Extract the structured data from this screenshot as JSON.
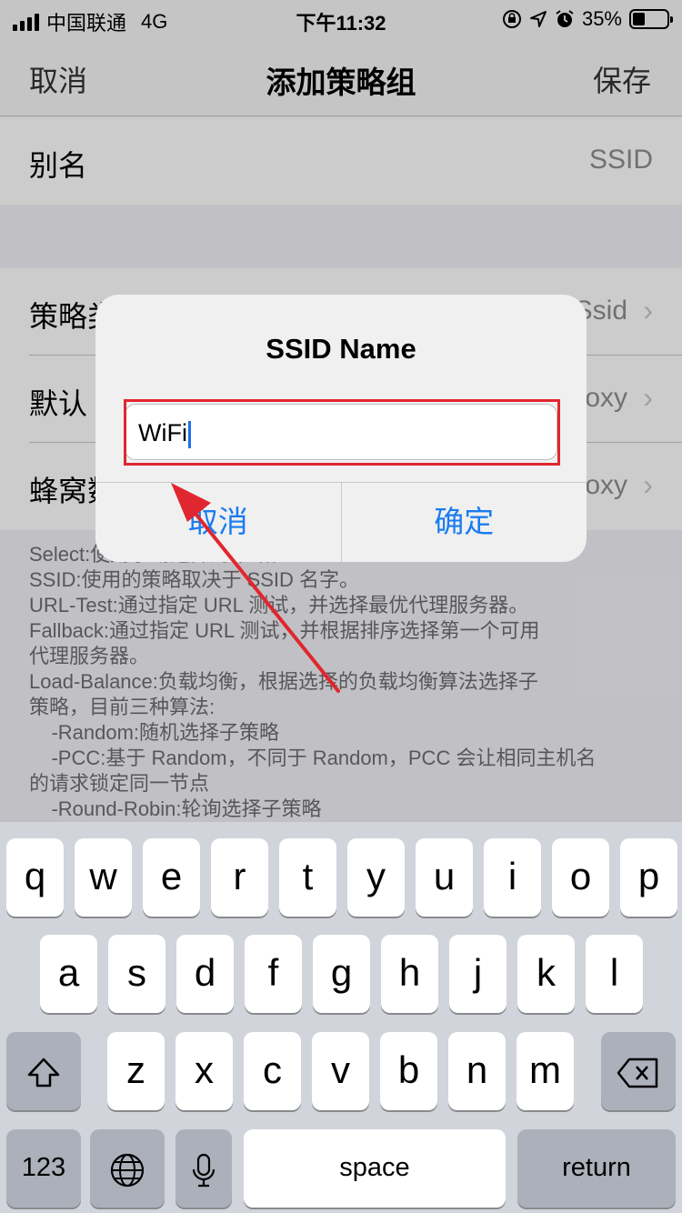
{
  "status_bar": {
    "carrier": "中国联通",
    "network": "4G",
    "time": "下午11:32",
    "battery": "35%",
    "battery_level": 0.35
  },
  "nav": {
    "cancel": "取消",
    "title": "添加策略组",
    "save": "保存"
  },
  "form": {
    "alias_label": "别名",
    "alias_placeholder": "SSID",
    "rows": [
      {
        "label": "策略类型",
        "value": "Ssid"
      },
      {
        "label": "默认",
        "value": "Proxy"
      },
      {
        "label": "蜂窝数据",
        "value": "Proxy"
      }
    ]
  },
  "description": "Select:使用手动选择的策略。\nSSID:使用的策略取决于 SSID 名字。\nURL-Test:通过指定 URL 测试，并选择最优代理服务器。\nFallback:通过指定 URL 测试，并根据排序选择第一个可用\n代理服务器。\nLoad-Balance:负载均衡，根据选择的负载均衡算法选择子\n策略，目前三种算法:\n    -Random:随机选择子策略\n    -PCC:基于 Random，不同于 Random，PCC 会让相同主机名\n的请求锁定同一节点\n    -Round-Robin:轮询选择子策略",
  "alert": {
    "title": "SSID Name",
    "input_value": "WiFi",
    "cancel": "取消",
    "confirm": "确定"
  },
  "keyboard": {
    "row1": [
      "q",
      "w",
      "e",
      "r",
      "t",
      "y",
      "u",
      "i",
      "o",
      "p"
    ],
    "row2": [
      "a",
      "s",
      "d",
      "f",
      "g",
      "h",
      "j",
      "k",
      "l"
    ],
    "row3": [
      "z",
      "x",
      "c",
      "v",
      "b",
      "n",
      "m"
    ],
    "numbers": "123",
    "space": "space",
    "return": "return"
  },
  "colors": {
    "accent": "#1a7cf0",
    "annotation": "#e0262f"
  }
}
